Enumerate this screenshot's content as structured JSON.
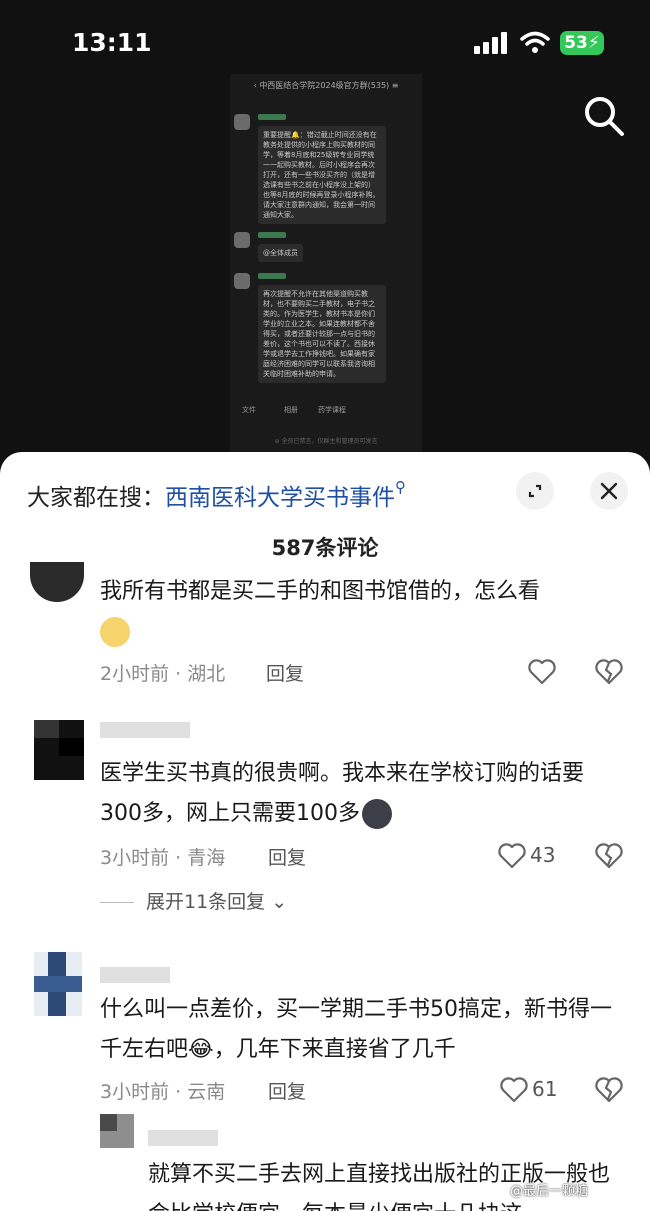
{
  "status_bar": {
    "time": "13:11",
    "battery": "53"
  },
  "embedded_chat": {
    "title": "中西医结合学院2024级官方群(535)",
    "message_1": "重要提醒🔔：错过截止时间还没有在教务处提供的小程序上购买教材的同学，等着8月底和25级转专业同学统一一起购买教材。后时小程序会再次打开，还有一些书没买齐的（就是增选课有些书之前在小程序没上架的）也等8月底的时候再登录小程序补购。请大家注意群内通知，我会第一时间通知大家。",
    "message_2": "@全体成员",
    "message_3": "再次提醒不允许在其他渠道购买教材，也不要购买二手教材，电子书之类的。作为医学生，教材书本是你们学业的立业之本。如果连教材都不舍得买，或者还要计较那一点与旧书的差价，这个书也可以不读了。西接休学或退学去工作挣钱吧。如果确有家庭经济困难的同学可以联系我咨询相关临时困难补助的申请。",
    "bar_items": [
      "文件",
      "相册",
      "药学课程"
    ],
    "hint": "⊘ 全员已禁言，仅群主和管理员可发言"
  },
  "sheet": {
    "search_prefix": "大家都在搜：",
    "search_keyword": "西南医科大学买书事件",
    "comment_count": "587条评论",
    "comments": [
      {
        "text": "我所有书都是买二手的和图书馆借的，怎么看",
        "meta": "2小时前 · 湖北",
        "reply": "回复",
        "likes": ""
      },
      {
        "text": "医学生买书真的很贵啊。我本来在学校订购的话要300多，网上只需要100多",
        "meta": "3小时前 · 青海",
        "reply": "回复",
        "likes": "43"
      },
      {
        "text": "什么叫一点差价，买一学期二手书50搞定，新书得一千左右吧😂，几年下来直接省了几千",
        "meta": "3小时前 · 云南",
        "reply": "回复",
        "likes": "61"
      },
      {
        "text": "就算不买二手去网上直接找出版社的正版一般也会比学校便宜，每本最少便宜十几块这"
      }
    ],
    "expand_label": "展开11条回复",
    "watermark": "@最后一颗糖"
  },
  "colors": {
    "keyword": "#1e4fa3",
    "battery": "#34c759",
    "sheet_bg": "#ffffff",
    "page_bg": "#111111"
  }
}
